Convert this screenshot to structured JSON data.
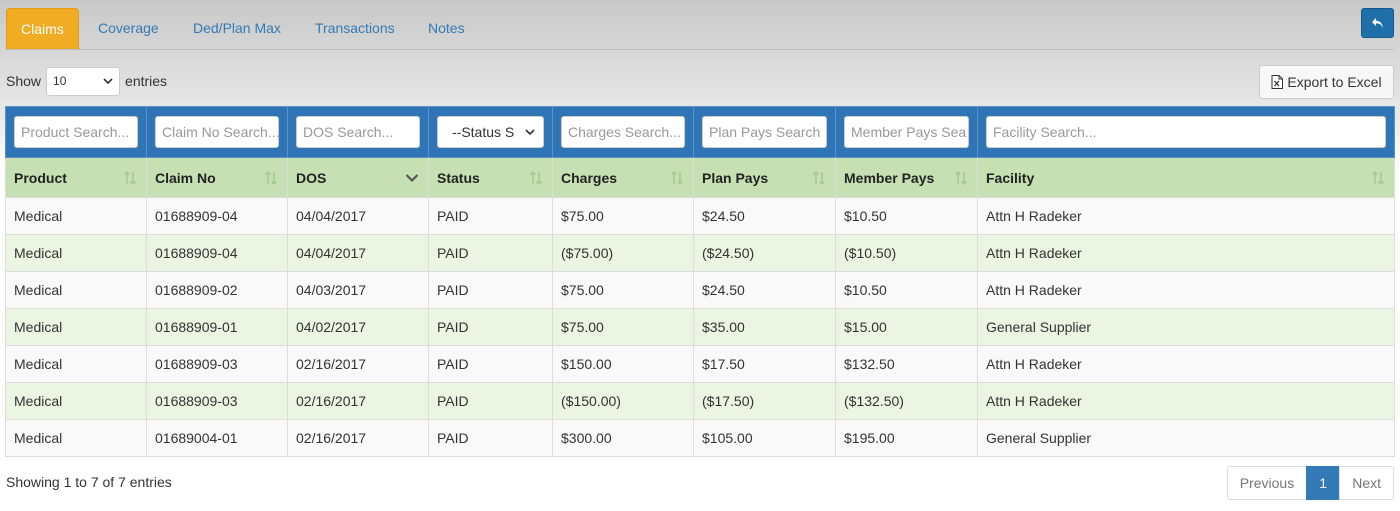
{
  "tabs": [
    {
      "label": "Claims"
    },
    {
      "label": "Coverage"
    },
    {
      "label": "Ded/Plan Max"
    },
    {
      "label": "Transactions"
    },
    {
      "label": "Notes"
    }
  ],
  "length": {
    "show": "Show",
    "value": "10",
    "entries": "entries"
  },
  "export_label": "Export to Excel",
  "search": {
    "product": "Product Search...",
    "claim_no": "Claim No Search...",
    "dos": "DOS Search...",
    "status": "--Status S",
    "charges": "Charges Search...",
    "plan_pays": "Plan Pays Search",
    "member_pays": "Member Pays Sea",
    "facility": "Facility Search..."
  },
  "columns": [
    "Product",
    "Claim No",
    "DOS",
    "Status",
    "Charges",
    "Plan Pays",
    "Member Pays",
    "Facility"
  ],
  "rows": [
    [
      "Medical",
      "01688909-04",
      "04/04/2017",
      "PAID",
      "$75.00",
      "$24.50",
      "$10.50",
      "Attn H Radeker"
    ],
    [
      "Medical",
      "01688909-04",
      "04/04/2017",
      "PAID",
      "($75.00)",
      "($24.50)",
      "($10.50)",
      "Attn H Radeker"
    ],
    [
      "Medical",
      "01688909-02",
      "04/03/2017",
      "PAID",
      "$75.00",
      "$24.50",
      "$10.50",
      "Attn H Radeker"
    ],
    [
      "Medical",
      "01688909-01",
      "04/02/2017",
      "PAID",
      "$75.00",
      "$35.00",
      "$15.00",
      "General Supplier"
    ],
    [
      "Medical",
      "01688909-03",
      "02/16/2017",
      "PAID",
      "$150.00",
      "$17.50",
      "$132.50",
      "Attn H Radeker"
    ],
    [
      "Medical",
      "01688909-03",
      "02/16/2017",
      "PAID",
      "($150.00)",
      "($17.50)",
      "($132.50)",
      "Attn H Radeker"
    ],
    [
      "Medical",
      "01689004-01",
      "02/16/2017",
      "PAID",
      "$300.00",
      "$105.00",
      "$195.00",
      "General Supplier"
    ]
  ],
  "info": "Showing 1 to 7 of 7 entries",
  "pager": {
    "previous": "Previous",
    "current": "1",
    "next": "Next"
  },
  "colors": {
    "active_tab": "#f0ad24",
    "search_bar": "#2f75b5",
    "header": "#c6e0b4",
    "even_row": "#ebf5e2",
    "page_current": "#337ab7"
  },
  "icons": {
    "back": "undo-arrow-icon",
    "export": "excel-file-icon",
    "sort": "sort-both-icon",
    "sorted": "sort-desc-icon"
  }
}
